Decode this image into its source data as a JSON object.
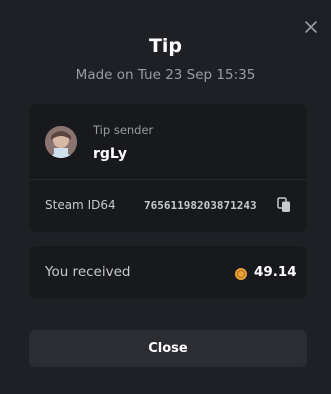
{
  "modal": {
    "title": "Tip",
    "subtitle": "Made on Tue 23 Sep 15:35",
    "close_icon": "close-icon"
  },
  "sender": {
    "label": "Tip sender",
    "name": "rgLy",
    "avatar": "avatar"
  },
  "steam": {
    "label": "Steam ID64",
    "value": "76561198203871243",
    "copy_icon": "copy-icon"
  },
  "received": {
    "label": "You received",
    "coin_icon": "coin-icon",
    "amount": "49.14"
  },
  "footer": {
    "close_label": "Close"
  },
  "colors": {
    "background": "#1f2025",
    "card": "#18191d",
    "muted_text": "#9a9ca3",
    "coin": "#e8a33d",
    "button": "#2c2d33"
  }
}
